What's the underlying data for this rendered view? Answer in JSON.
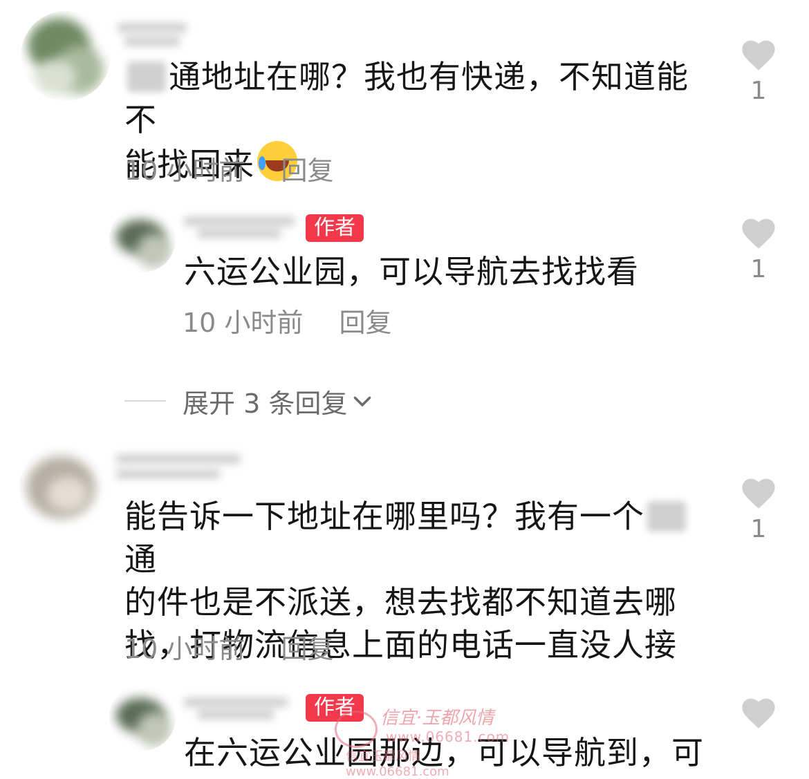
{
  "comments": [
    {
      "text_prefix": "通地址在哪？我也有快递，不知道能不",
      "text_line2": "能找回来",
      "emoji": "rofl-emoji",
      "time": "10 小时前",
      "reply_label": "回复",
      "likes": "1"
    },
    {
      "badge": "作者",
      "text": "六运公业园，可以导航去找找看",
      "time": "10 小时前",
      "reply_label": "回复",
      "likes": "1"
    },
    {
      "line1_prefix": "能告诉一下地址在哪里吗？我有一个",
      "line1_suffix": "通",
      "line2": "的件也是不派送，想去找都不知道去哪",
      "line3": "找，打物流信息上面的电话一直没人接",
      "time": "10 小时前",
      "reply_label": "回复",
      "likes": "1"
    },
    {
      "badge": "作者",
      "text": "在六运公业园那边，可以导航到，可"
    }
  ],
  "expand_replies": "展开 3 条回复",
  "watermark": {
    "title": "信宜·玉都风情",
    "url": "www.06681.com",
    "url2": "信宜玉都风情  www.06681.com"
  },
  "colors": {
    "badge": "#f2394b",
    "meta": "#8a8a8a",
    "heart": "#cfcfcf"
  }
}
